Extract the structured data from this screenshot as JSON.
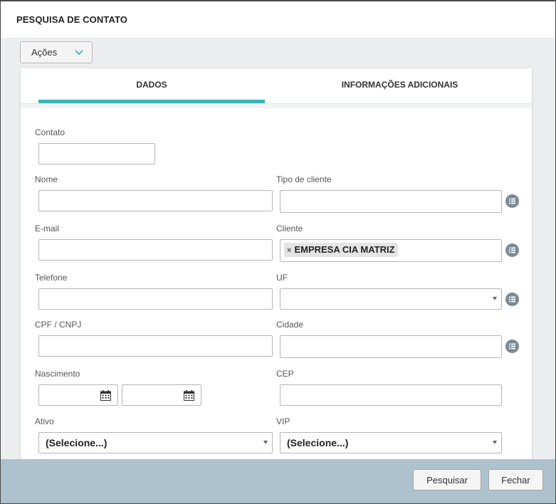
{
  "dialog": {
    "title": "PESQUISA DE CONTATO"
  },
  "actions": {
    "label": "Ações"
  },
  "tabs": [
    {
      "label": "DADOS",
      "active": true
    },
    {
      "label": "INFORMAÇÕES ADICIONAIS",
      "active": false
    }
  ],
  "form": {
    "contato": {
      "label": "Contato",
      "value": ""
    },
    "nome": {
      "label": "Nome",
      "value": ""
    },
    "tipo_cliente": {
      "label": "Tipo de cliente",
      "value": ""
    },
    "email": {
      "label": "E-mail",
      "value": ""
    },
    "cliente": {
      "label": "Cliente",
      "tag": "EMPRESA CIA MATRIZ",
      "remove": "×"
    },
    "telefone": {
      "label": "Telefone",
      "value": ""
    },
    "uf": {
      "label": "UF",
      "selected": ""
    },
    "cpf_cnpj": {
      "label": "CPF / CNPJ",
      "value": ""
    },
    "cidade": {
      "label": "Cidade",
      "value": ""
    },
    "nascimento": {
      "label": "Nascimento",
      "from": "",
      "to": ""
    },
    "cep": {
      "label": "CEP",
      "value": ""
    },
    "ativo": {
      "label": "Ativo",
      "selected": "(Selecione...)"
    },
    "vip": {
      "label": "VIP",
      "selected": "(Selecione...)"
    }
  },
  "footer": {
    "search_label": "Pesquisar",
    "close_label": "Fechar"
  },
  "colors": {
    "accent": "#3bb6b6",
    "footer_bg": "#adc2cc",
    "icon": "#7a8a96"
  },
  "icons": {
    "list": "list-icon",
    "calendar": "calendar-icon",
    "chevron": "chevron-down-icon"
  }
}
